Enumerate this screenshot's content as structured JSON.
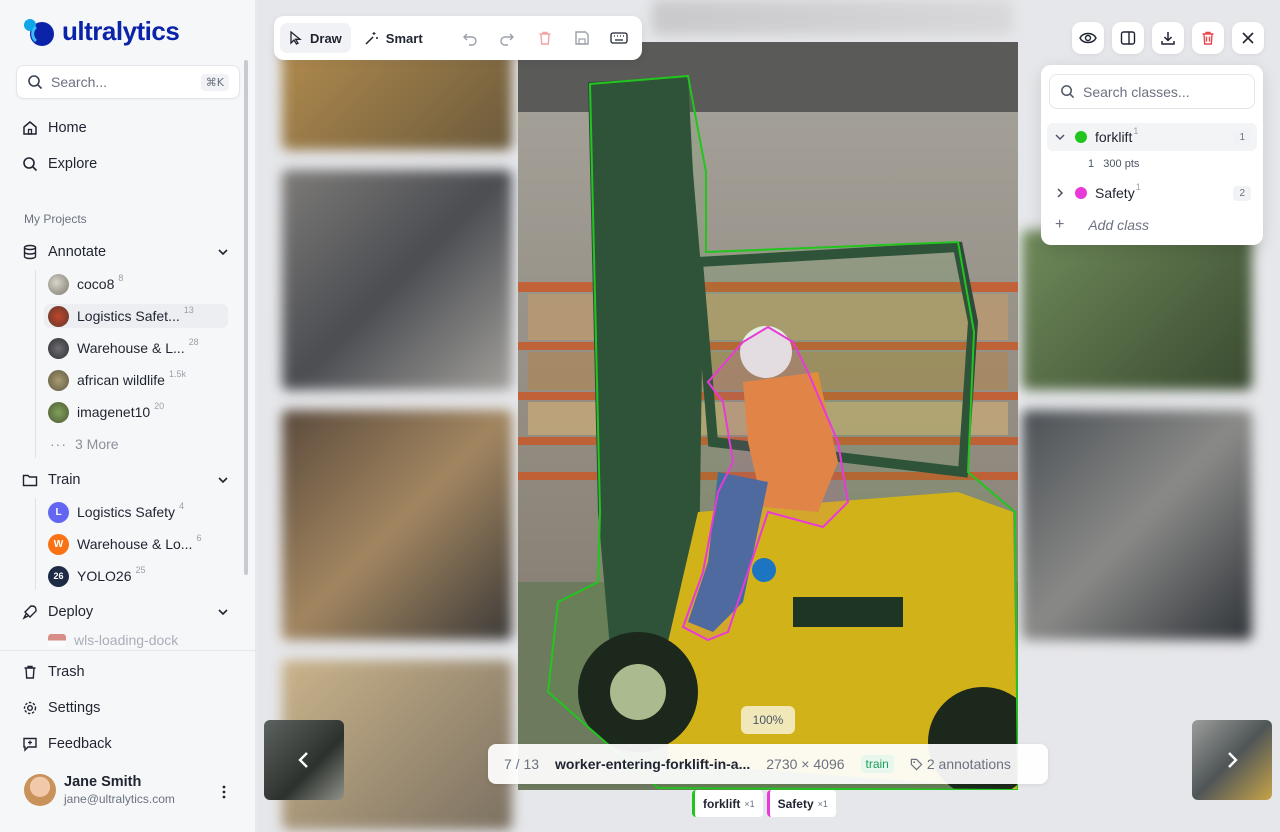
{
  "brand": {
    "name": "ultralytics",
    "accent": "#0b23a9"
  },
  "search": {
    "placeholder": "Search...",
    "shortcut": "⌘K"
  },
  "nav": {
    "home": "Home",
    "explore": "Explore",
    "section_label": "My Projects",
    "annotate": "Annotate",
    "train": "Train",
    "deploy": "Deploy",
    "trash": "Trash",
    "settings": "Settings",
    "feedback": "Feedback"
  },
  "annotate_projects": [
    {
      "name": "coco8",
      "count": "8"
    },
    {
      "name": "Logistics Safet...",
      "count": "13"
    },
    {
      "name": "Warehouse & L...",
      "count": "28"
    },
    {
      "name": "african wildlife",
      "count": "1.5k"
    },
    {
      "name": "imagenet10",
      "count": "20"
    }
  ],
  "more_label": "3 More",
  "train_projects": [
    {
      "name": "Logistics Safety",
      "count": "4",
      "badge": "L",
      "color": "#6366f1"
    },
    {
      "name": "Warehouse & Lo...",
      "count": "6",
      "badge": "W",
      "color": "#f97316"
    },
    {
      "name": "YOLO26",
      "count": "25",
      "badge": "26",
      "color": "#1f2a44"
    }
  ],
  "deploy_item": "wls-loading-dock",
  "user": {
    "name": "Jane Smith",
    "email": "jane@ultralytics.com"
  },
  "toolbar": {
    "draw": "Draw",
    "smart": "Smart"
  },
  "classes_panel": {
    "search_placeholder": "Search classes...",
    "classes": [
      {
        "name": "forklift",
        "sup": "1",
        "count": "1",
        "color": "#22c51e",
        "detail_index": "1",
        "detail": "300 pts"
      },
      {
        "name": "Safety",
        "sup": "1",
        "count": "2",
        "color": "#e83ad9"
      }
    ],
    "add_class": "Add class"
  },
  "image_info": {
    "position": "7 / 13",
    "filename": "worker-entering-forklift-in-a...",
    "dimensions": "2730 × 4096",
    "split": "train",
    "annotations": "2 annotations"
  },
  "zoom": "100%",
  "chips": [
    {
      "label": "forklift",
      "mult": "×1",
      "color": "#22c51e"
    },
    {
      "label": "Safety",
      "mult": "×1",
      "color": "#e83ad9"
    }
  ]
}
